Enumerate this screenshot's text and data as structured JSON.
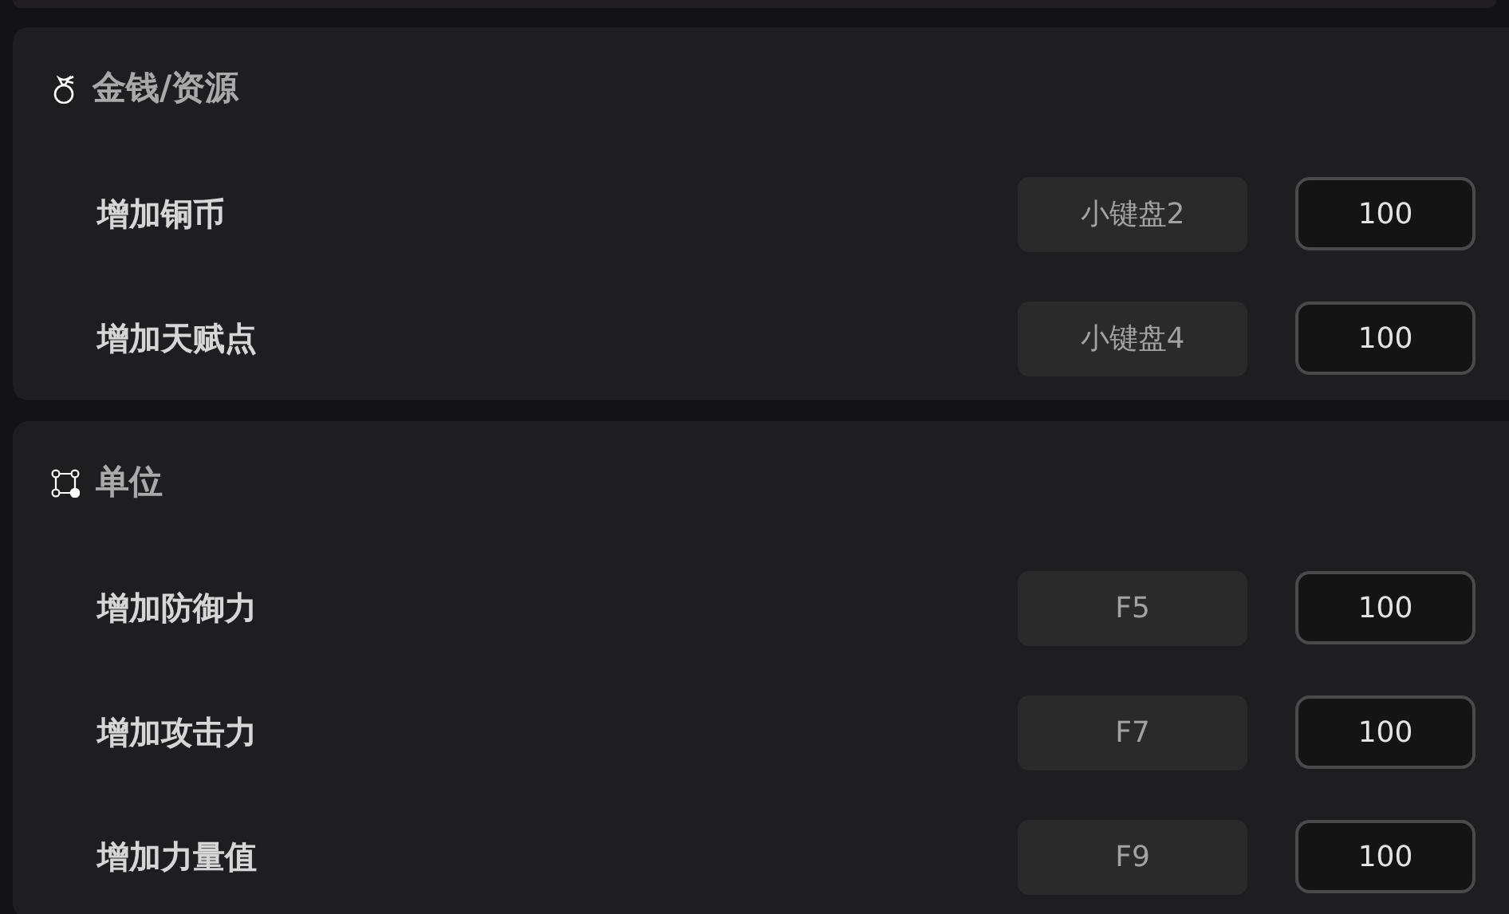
{
  "sections": [
    {
      "title": "金钱/资源",
      "rows": [
        {
          "label": "增加铜币",
          "hotkey": "小键盘2",
          "value": "100"
        },
        {
          "label": "增加天赋点",
          "hotkey": "小键盘4",
          "value": "100"
        }
      ]
    },
    {
      "title": "单位",
      "rows": [
        {
          "label": "增加防御力",
          "hotkey": "F5",
          "value": "100"
        },
        {
          "label": "增加攻击力",
          "hotkey": "F7",
          "value": "100"
        },
        {
          "label": "增加力量值",
          "hotkey": "F9",
          "value": "100"
        }
      ]
    }
  ]
}
